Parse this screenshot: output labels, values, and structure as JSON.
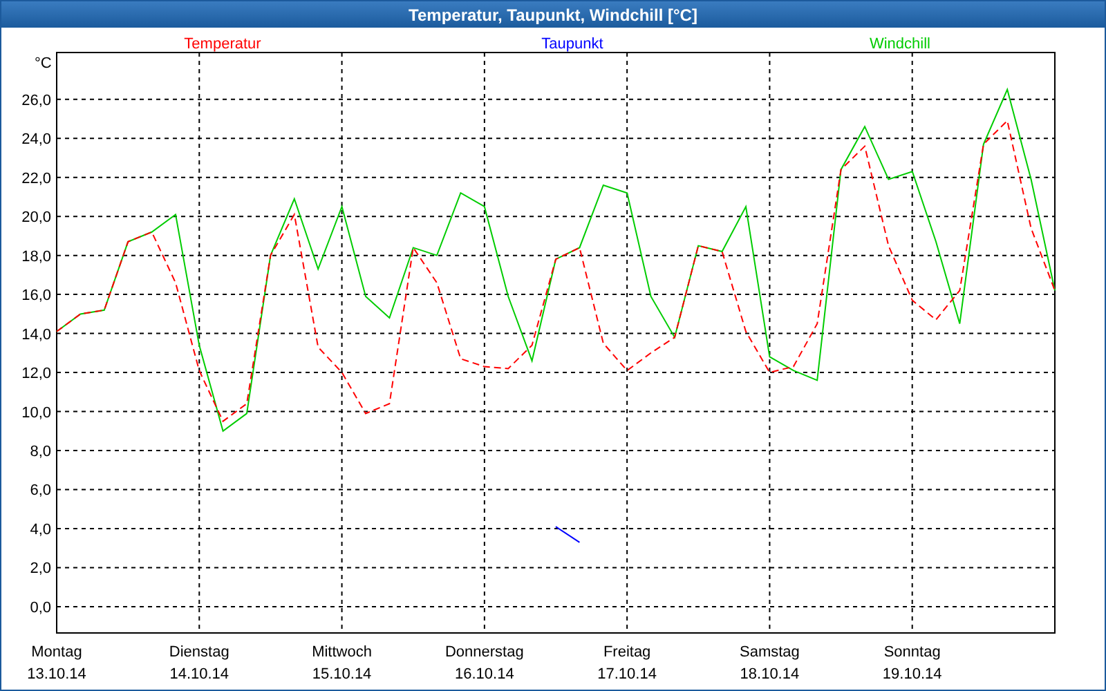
{
  "window": {
    "title": "Temperatur, Taupunkt, Windchill [°C]"
  },
  "chart": {
    "chart_data": {
      "type": "line",
      "ylabel": "°C",
      "categories": [
        "Montag 13.10.14",
        null,
        null,
        null,
        null,
        null,
        "Dienstag 14.10.14",
        null,
        null,
        null,
        null,
        null,
        "Mittwoch 15.10.14",
        null,
        null,
        null,
        null,
        null,
        "Donnerstag 16.10.14",
        null,
        null,
        null,
        null,
        null,
        "Freitag 17.10.14",
        null,
        null,
        null,
        null,
        null,
        "Samstag 18.10.14",
        null,
        null,
        null,
        null,
        null,
        "Sonntag 19.10.14",
        null,
        null,
        null,
        null,
        null,
        null
      ],
      "ylim": [
        -1.35,
        28.4
      ],
      "grid": true,
      "yticks": [
        {
          "value": 0,
          "label": "0,0"
        },
        {
          "value": 2,
          "label": "2,0"
        },
        {
          "value": 4,
          "label": "4,0"
        },
        {
          "value": 6,
          "label": "6,0"
        },
        {
          "value": 8,
          "label": "8,0"
        },
        {
          "value": 10,
          "label": "10,0"
        },
        {
          "value": 12,
          "label": "12,0"
        },
        {
          "value": 14,
          "label": "14,0"
        },
        {
          "value": 16,
          "label": "16,0"
        },
        {
          "value": 18,
          "label": "18,0"
        },
        {
          "value": 20,
          "label": "20,0"
        },
        {
          "value": 22,
          "label": "22,0"
        },
        {
          "value": 24,
          "label": "24,0"
        },
        {
          "value": 26,
          "label": "26,0"
        }
      ],
      "series": [
        {
          "name": "Temperatur",
          "color": "#ff0000",
          "line_style": "dashed",
          "values": [
            14.1,
            15.0,
            15.2,
            18.7,
            19.2,
            16.6,
            12.1,
            9.5,
            10.4,
            18.0,
            20.1,
            13.3,
            12.0,
            9.9,
            10.4,
            18.4,
            16.6,
            12.7,
            12.3,
            12.2,
            13.4,
            17.8,
            18.4,
            13.5,
            12.1,
            13.0,
            13.8,
            18.5,
            18.2,
            14.1,
            12.0,
            12.3,
            14.5,
            22.4,
            23.6,
            18.5,
            15.7,
            14.7,
            16.2,
            23.7,
            24.9,
            19.4,
            16.2
          ]
        },
        {
          "name": "Taupunkt",
          "color": "#0000ff",
          "values": [
            null,
            null,
            null,
            null,
            null,
            null,
            null,
            null,
            null,
            null,
            null,
            null,
            null,
            null,
            null,
            null,
            null,
            null,
            null,
            null,
            null,
            4.1,
            3.3,
            null,
            null,
            null,
            null,
            null,
            null,
            null,
            null,
            null,
            null,
            null,
            null,
            null,
            null,
            null,
            null,
            null,
            null,
            null,
            null
          ]
        },
        {
          "name": "Windchill",
          "color": "#00cc00",
          "values": [
            14.1,
            15.0,
            15.2,
            18.7,
            19.2,
            20.1,
            13.4,
            9.0,
            9.9,
            18.0,
            20.9,
            17.3,
            20.5,
            15.9,
            14.8,
            18.4,
            18.0,
            21.2,
            20.5,
            15.9,
            12.6,
            17.8,
            18.4,
            21.6,
            21.2,
            15.9,
            13.8,
            18.5,
            18.2,
            20.5,
            12.8,
            12.1,
            11.6,
            22.4,
            24.6,
            21.9,
            22.3,
            18.7,
            14.5,
            23.7,
            26.5,
            21.9,
            16.2
          ]
        }
      ]
    }
  }
}
